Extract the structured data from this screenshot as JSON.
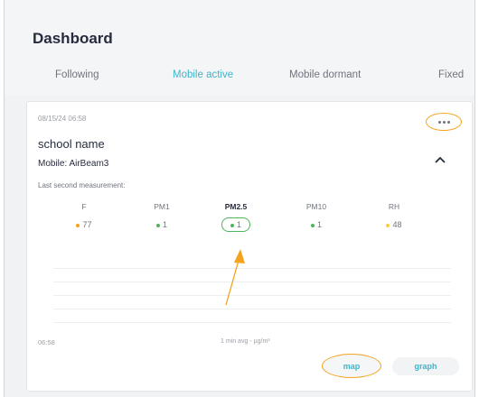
{
  "header": {
    "title": "Dashboard",
    "tabs": [
      {
        "label": "Following",
        "active": false
      },
      {
        "label": "Mobile active",
        "active": true
      },
      {
        "label": "Mobile dormant",
        "active": false
      },
      {
        "label": "Fixed",
        "active": false
      }
    ]
  },
  "session_card": {
    "timestamp": "08/15/24 06:58",
    "name": "school name",
    "device": "Mobile: AirBeam3",
    "last_measurement_label": "Last second measurement:",
    "more_icon": "ellipsis-icon",
    "collapse_icon": "chevron-up-icon",
    "measurements": [
      {
        "label": "F",
        "value": "77",
        "dot_color": "#f4a31d",
        "active": false
      },
      {
        "label": "PM1",
        "value": "1",
        "dot_color": "#4fb55a",
        "active": false
      },
      {
        "label": "PM2.5",
        "value": "1",
        "dot_color": "#4fb55a",
        "active": true
      },
      {
        "label": "PM10",
        "value": "1",
        "dot_color": "#4fb55a",
        "active": false
      },
      {
        "label": "RH",
        "value": "48",
        "dot_color": "#f7d03c",
        "active": false
      }
    ],
    "graph_time": "06:58",
    "graph_unit": "1 min avg - µg/m³",
    "map_label": "map",
    "graph_label": "graph"
  },
  "colors": {
    "accent": "#3fb4c9",
    "annotation": "#f4a31d",
    "highlight_green": "#4fb55a",
    "title_text": "#262c3e"
  }
}
